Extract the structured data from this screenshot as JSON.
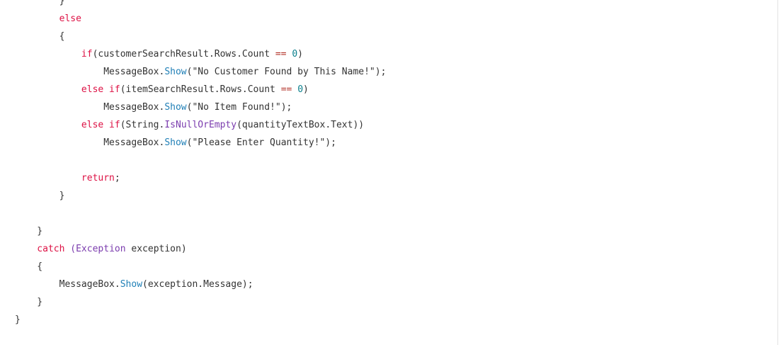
{
  "code": {
    "lines": [
      [
        {
          "t": "ident",
          "v": "        }"
        }
      ],
      [
        {
          "t": "keyword",
          "v": "        else"
        }
      ],
      [
        {
          "t": "ident",
          "v": "        {"
        }
      ],
      [
        {
          "t": "keyword",
          "v": "            if"
        },
        {
          "t": "ident",
          "v": "(customerSearchResult.Rows.Count "
        },
        {
          "t": "op",
          "v": "=="
        },
        {
          "t": "ident",
          "v": " "
        },
        {
          "t": "number",
          "v": "0"
        },
        {
          "t": "ident",
          "v": ")"
        }
      ],
      [
        {
          "t": "ident",
          "v": "                MessageBox."
        },
        {
          "t": "method",
          "v": "Show"
        },
        {
          "t": "ident",
          "v": "(\"No Customer Found by This Name!\");"
        }
      ],
      [
        {
          "t": "keyword",
          "v": "            else if"
        },
        {
          "t": "ident",
          "v": "(itemSearchResult.Rows.Count "
        },
        {
          "t": "op",
          "v": "=="
        },
        {
          "t": "ident",
          "v": " "
        },
        {
          "t": "number",
          "v": "0"
        },
        {
          "t": "ident",
          "v": ")"
        }
      ],
      [
        {
          "t": "ident",
          "v": "                MessageBox."
        },
        {
          "t": "method",
          "v": "Show"
        },
        {
          "t": "ident",
          "v": "(\"No Item Found!\");"
        }
      ],
      [
        {
          "t": "keyword",
          "v": "            else if"
        },
        {
          "t": "ident",
          "v": "(String."
        },
        {
          "t": "kwtype",
          "v": "IsNullOrEmpty"
        },
        {
          "t": "ident",
          "v": "(quantityTextBox.Text))"
        }
      ],
      [
        {
          "t": "ident",
          "v": "                MessageBox."
        },
        {
          "t": "method",
          "v": "Show"
        },
        {
          "t": "ident",
          "v": "(\"Please Enter Quantity!\");"
        }
      ],
      [
        {
          "t": "ident",
          "v": ""
        }
      ],
      [
        {
          "t": "keyword",
          "v": "            return"
        },
        {
          "t": "ident",
          "v": ";"
        }
      ],
      [
        {
          "t": "ident",
          "v": "        }"
        }
      ],
      [
        {
          "t": "ident",
          "v": ""
        }
      ],
      [
        {
          "t": "ident",
          "v": "    }"
        }
      ],
      [
        {
          "t": "keyword",
          "v": "    catch"
        },
        {
          "t": "ident",
          "v": " "
        },
        {
          "t": "kwtype",
          "v": "(Exception"
        },
        {
          "t": "ident",
          "v": " exception)"
        }
      ],
      [
        {
          "t": "ident",
          "v": "    {"
        }
      ],
      [
        {
          "t": "ident",
          "v": "        MessageBox."
        },
        {
          "t": "method",
          "v": "Show"
        },
        {
          "t": "ident",
          "v": "(exception.Message);"
        }
      ],
      [
        {
          "t": "ident",
          "v": "    }"
        }
      ],
      [
        {
          "t": "ident",
          "v": "}"
        }
      ]
    ]
  },
  "colors": {
    "keyword": "#d14",
    "method": "#1f7fb6",
    "kwtype": "#7b3cae",
    "number": "#0a7f8c",
    "op": "#b3332a",
    "text": "#333333",
    "background": "#ffffff"
  }
}
